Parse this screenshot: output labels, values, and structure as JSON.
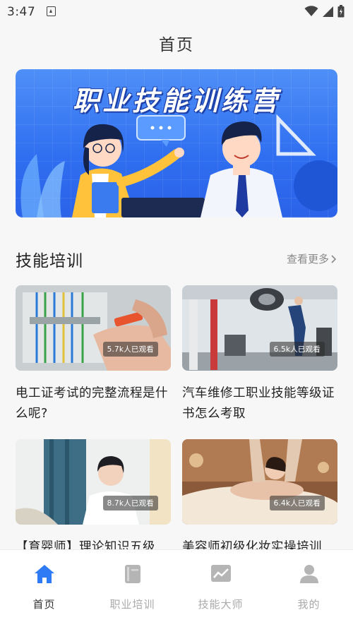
{
  "status_bar": {
    "time": "3:47"
  },
  "header": {
    "title": "首页"
  },
  "banner": {
    "title": "职业技能训练营"
  },
  "section": {
    "title": "技能培训",
    "more_label": "查看更多"
  },
  "courses": [
    {
      "title": "电工证考试的完整流程是什么呢?",
      "views": "5.7k人已观看",
      "thumb_icon": "electrical-wiring-photo"
    },
    {
      "title": "汽车维修工职业技能等级证书怎么考取",
      "views": "6.5k人已观看",
      "thumb_icon": "car-repair-photo"
    },
    {
      "title": "【育婴师】理论知识五级",
      "views": "8.7k人已观看",
      "thumb_icon": "childcare-photo"
    },
    {
      "title": "美容师初级化妆实操培训",
      "views": "6.4k人已观看",
      "thumb_icon": "beauty-massage-photo"
    }
  ],
  "tabbar": {
    "items": [
      {
        "label": "首页",
        "icon": "home-icon",
        "active": true
      },
      {
        "label": "职业培训",
        "icon": "book-icon",
        "active": false
      },
      {
        "label": "技能大师",
        "icon": "chart-icon",
        "active": false
      },
      {
        "label": "我的",
        "icon": "user-icon",
        "active": false
      }
    ]
  },
  "colors": {
    "accent": "#2f7bf5",
    "banner": "#2f6ef0",
    "inactive": "#b5b5b5"
  }
}
